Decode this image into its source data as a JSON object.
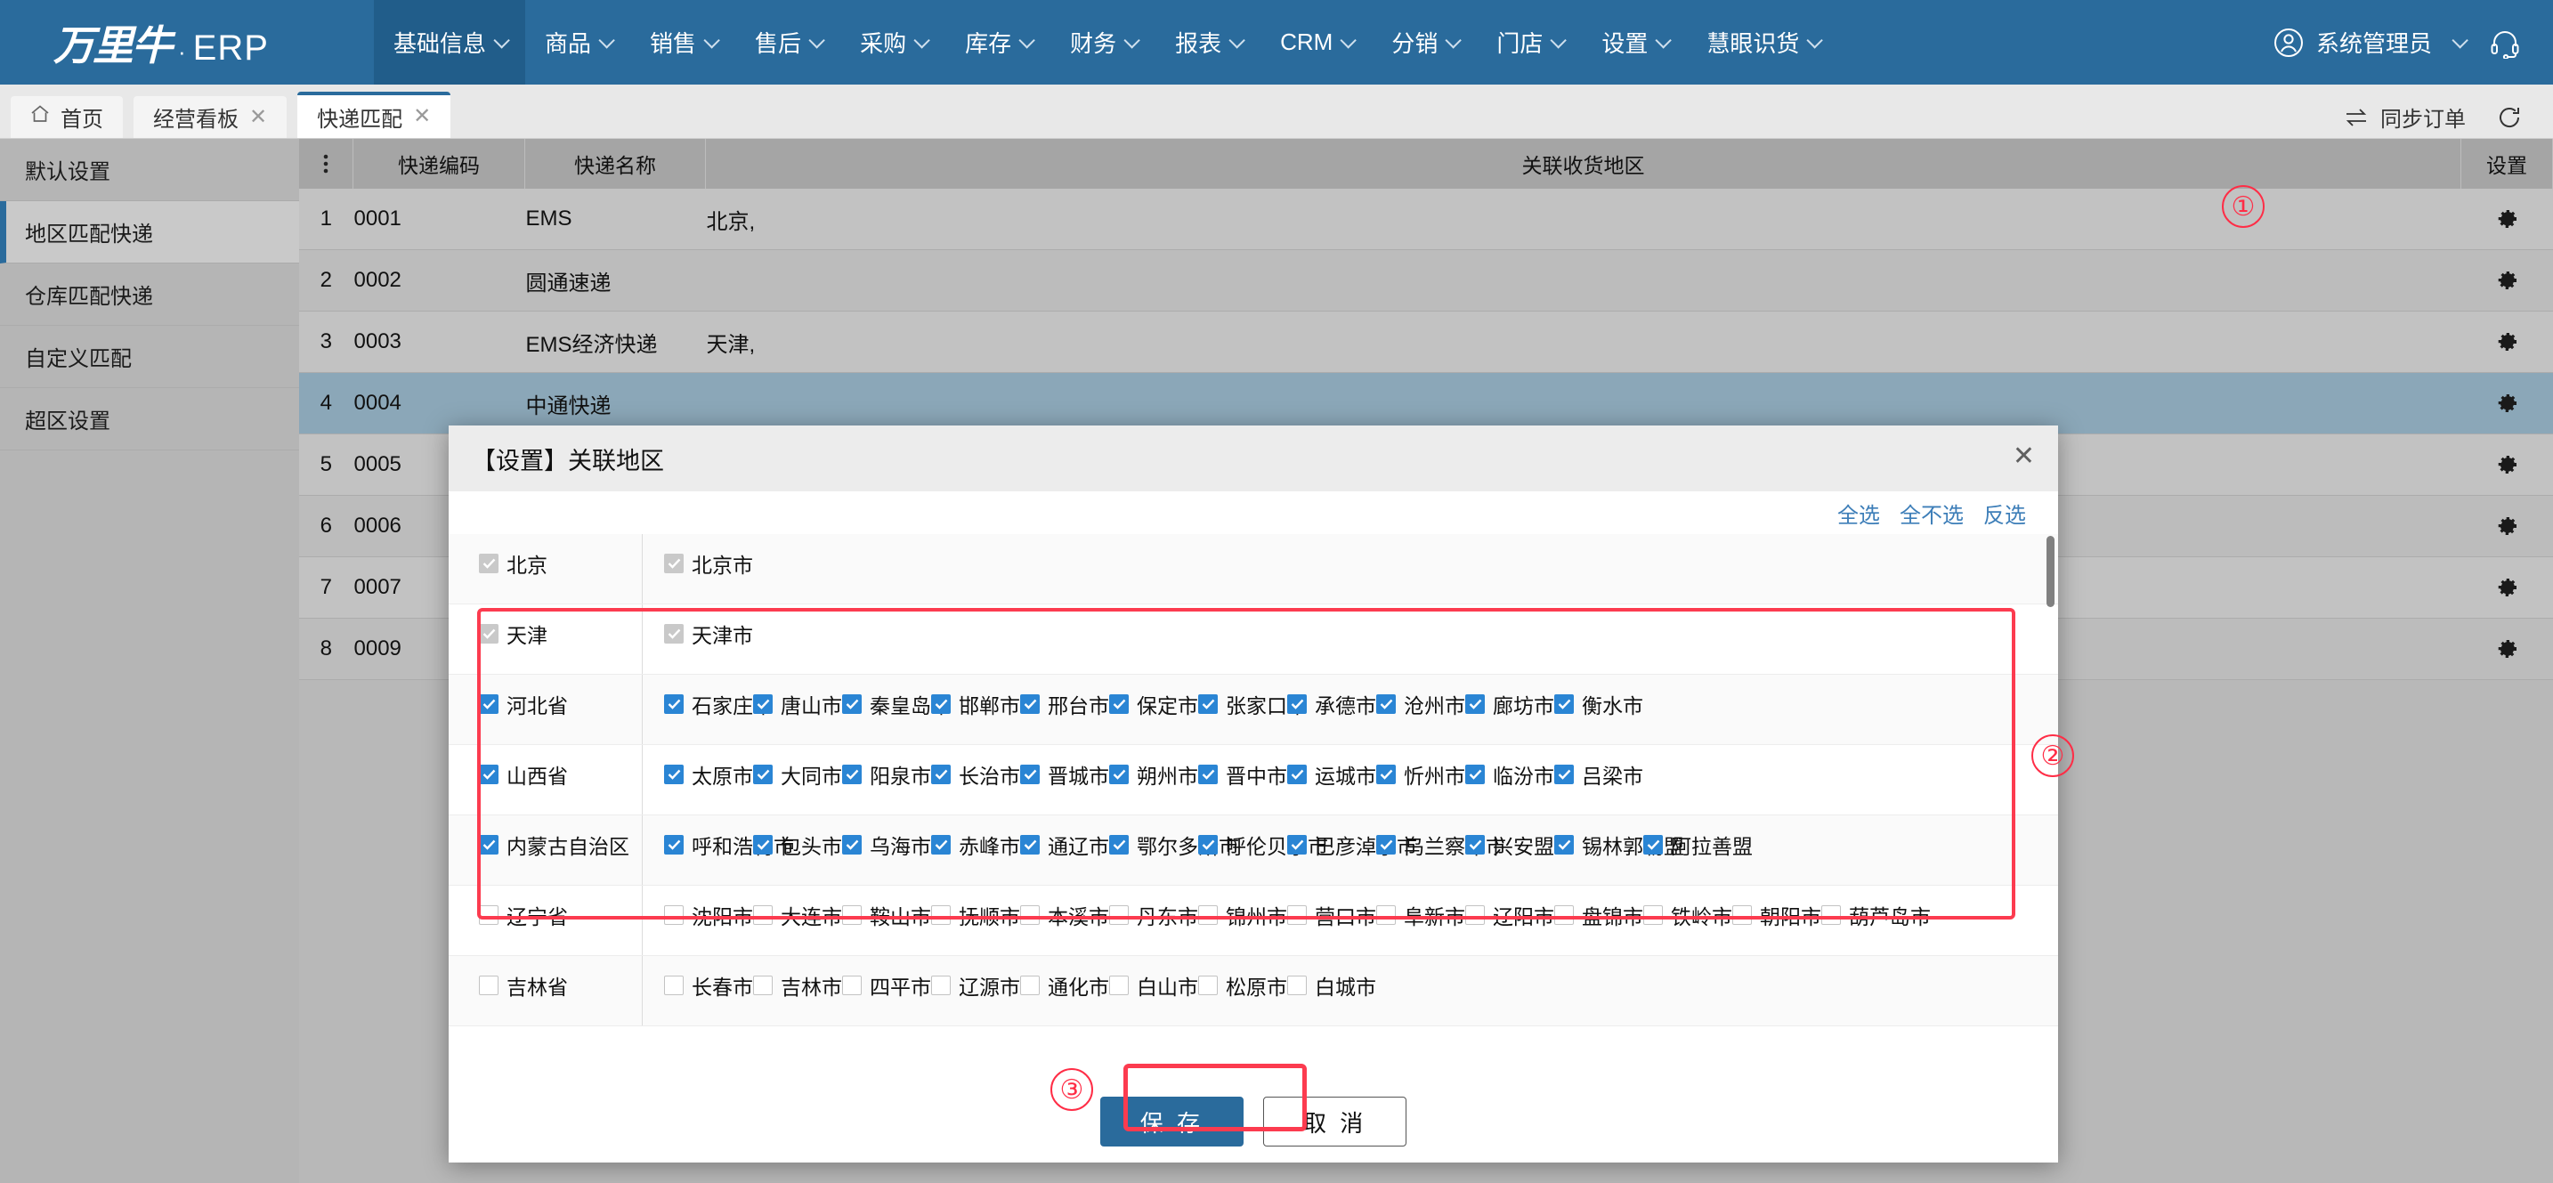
{
  "brand": {
    "logo_cn": "万里牛",
    "dot": "·",
    "erp": "ERP"
  },
  "topnav": {
    "items": [
      {
        "label": "基础信息",
        "active": true
      },
      {
        "label": "商品",
        "active": false
      },
      {
        "label": "销售",
        "active": false
      },
      {
        "label": "售后",
        "active": false
      },
      {
        "label": "采购",
        "active": false
      },
      {
        "label": "库存",
        "active": false
      },
      {
        "label": "财务",
        "active": false
      },
      {
        "label": "报表",
        "active": false
      },
      {
        "label": "CRM",
        "active": false
      },
      {
        "label": "分销",
        "active": false
      },
      {
        "label": "门店",
        "active": false
      },
      {
        "label": "设置",
        "active": false
      },
      {
        "label": "慧眼识货",
        "active": false
      }
    ],
    "user": "系统管理员",
    "accent": "#2a6b9c"
  },
  "tabbar": {
    "tabs": [
      {
        "label": "首页",
        "closable": false,
        "active": false
      },
      {
        "label": "经营看板",
        "closable": true,
        "active": false
      },
      {
        "label": "快递匹配",
        "closable": true,
        "active": true
      }
    ],
    "sync_label": "同步订单"
  },
  "sidebar": {
    "items": [
      {
        "label": "默认设置",
        "selected": false
      },
      {
        "label": "地区匹配快递",
        "selected": true
      },
      {
        "label": "仓库匹配快递",
        "selected": false
      },
      {
        "label": "自定义匹配",
        "selected": false
      },
      {
        "label": "超区设置",
        "selected": false
      }
    ]
  },
  "grid": {
    "columns": [
      "",
      "快递编码",
      "快递名称",
      "关联收货地区",
      "设置"
    ],
    "rows": [
      {
        "idx": "1",
        "code": "0001",
        "name": "EMS",
        "region": "北京,",
        "selected": false
      },
      {
        "idx": "2",
        "code": "0002",
        "name": "圆通速递",
        "region": "",
        "selected": false
      },
      {
        "idx": "3",
        "code": "0003",
        "name": "EMS经济快递",
        "region": "天津,",
        "selected": false
      },
      {
        "idx": "4",
        "code": "0004",
        "name": "中通快递",
        "region": "",
        "selected": true
      },
      {
        "idx": "5",
        "code": "0005",
        "name": "",
        "region": "",
        "selected": false
      },
      {
        "idx": "6",
        "code": "0006",
        "name": "",
        "region": "",
        "selected": false
      },
      {
        "idx": "7",
        "code": "0007",
        "name": "",
        "region": "",
        "selected": false
      },
      {
        "idx": "8",
        "code": "0009",
        "name": "",
        "region": "",
        "selected": false
      }
    ]
  },
  "dialog": {
    "title": "【设置】关联地区",
    "close": "✕",
    "tools": [
      {
        "label": "全选"
      },
      {
        "label": "全不选"
      },
      {
        "label": "反选"
      }
    ],
    "provinces": [
      {
        "name": "北京",
        "state": "disabled-checked",
        "cities": [
          {
            "label": "北京市",
            "state": "disabled-checked"
          }
        ]
      },
      {
        "name": "天津",
        "state": "disabled-checked",
        "cities": [
          {
            "label": "天津市",
            "state": "disabled-checked"
          }
        ]
      },
      {
        "name": "河北省",
        "state": "checked",
        "cities": [
          {
            "label": "石家庄市",
            "state": "checked"
          },
          {
            "label": "唐山市",
            "state": "checked"
          },
          {
            "label": "秦皇岛市",
            "state": "checked"
          },
          {
            "label": "邯郸市",
            "state": "checked"
          },
          {
            "label": "邢台市",
            "state": "checked"
          },
          {
            "label": "保定市",
            "state": "checked"
          },
          {
            "label": "张家口市",
            "state": "checked"
          },
          {
            "label": "承德市",
            "state": "checked"
          },
          {
            "label": "沧州市",
            "state": "checked"
          },
          {
            "label": "廊坊市",
            "state": "checked"
          },
          {
            "label": "衡水市",
            "state": "checked"
          }
        ]
      },
      {
        "name": "山西省",
        "state": "checked",
        "cities": [
          {
            "label": "太原市",
            "state": "checked"
          },
          {
            "label": "大同市",
            "state": "checked"
          },
          {
            "label": "阳泉市",
            "state": "checked"
          },
          {
            "label": "长治市",
            "state": "checked"
          },
          {
            "label": "晋城市",
            "state": "checked"
          },
          {
            "label": "朔州市",
            "state": "checked"
          },
          {
            "label": "晋中市",
            "state": "checked"
          },
          {
            "label": "运城市",
            "state": "checked"
          },
          {
            "label": "忻州市",
            "state": "checked"
          },
          {
            "label": "临汾市",
            "state": "checked"
          },
          {
            "label": "吕梁市",
            "state": "checked"
          }
        ]
      },
      {
        "name": "内蒙古自治区",
        "state": "checked",
        "cities": [
          {
            "label": "呼和浩特市",
            "state": "checked"
          },
          {
            "label": "包头市",
            "state": "checked"
          },
          {
            "label": "乌海市",
            "state": "checked"
          },
          {
            "label": "赤峰市",
            "state": "checked"
          },
          {
            "label": "通辽市",
            "state": "checked"
          },
          {
            "label": "鄂尔多斯市",
            "state": "checked"
          },
          {
            "label": "呼伦贝尔市",
            "state": "checked"
          },
          {
            "label": "巴彦淖尔市",
            "state": "checked"
          },
          {
            "label": "乌兰察布市",
            "state": "checked"
          },
          {
            "label": "兴安盟",
            "state": "checked"
          },
          {
            "label": "锡林郭勒盟",
            "state": "checked"
          },
          {
            "label": "阿拉善盟",
            "state": "checked"
          }
        ]
      },
      {
        "name": "辽宁省",
        "state": "unchecked",
        "cities": [
          {
            "label": "沈阳市",
            "state": "unchecked"
          },
          {
            "label": "大连市",
            "state": "unchecked"
          },
          {
            "label": "鞍山市",
            "state": "unchecked"
          },
          {
            "label": "抚顺市",
            "state": "unchecked"
          },
          {
            "label": "本溪市",
            "state": "unchecked"
          },
          {
            "label": "丹东市",
            "state": "unchecked"
          },
          {
            "label": "锦州市",
            "state": "unchecked"
          },
          {
            "label": "营口市",
            "state": "unchecked"
          },
          {
            "label": "阜新市",
            "state": "unchecked"
          },
          {
            "label": "辽阳市",
            "state": "unchecked"
          },
          {
            "label": "盘锦市",
            "state": "unchecked"
          },
          {
            "label": "铁岭市",
            "state": "unchecked"
          },
          {
            "label": "朝阳市",
            "state": "unchecked"
          },
          {
            "label": "葫芦岛市",
            "state": "unchecked"
          }
        ]
      },
      {
        "name": "吉林省",
        "state": "unchecked",
        "cities": [
          {
            "label": "长春市",
            "state": "unchecked"
          },
          {
            "label": "吉林市",
            "state": "unchecked"
          },
          {
            "label": "四平市",
            "state": "unchecked"
          },
          {
            "label": "辽源市",
            "state": "unchecked"
          },
          {
            "label": "通化市",
            "state": "unchecked"
          },
          {
            "label": "白山市",
            "state": "unchecked"
          },
          {
            "label": "松原市",
            "state": "unchecked"
          },
          {
            "label": "白城市",
            "state": "unchecked"
          }
        ]
      }
    ],
    "save_label": "保 存",
    "cancel_label": "取 消"
  },
  "annotations": [
    {
      "label": "①"
    },
    {
      "label": "②"
    },
    {
      "label": "③"
    }
  ],
  "colors": {
    "brand_blue": "#2a6b9c",
    "anno_red": "#fc3b4f",
    "link_blue": "#3d7eb8",
    "check_blue": "#2a85d4"
  }
}
